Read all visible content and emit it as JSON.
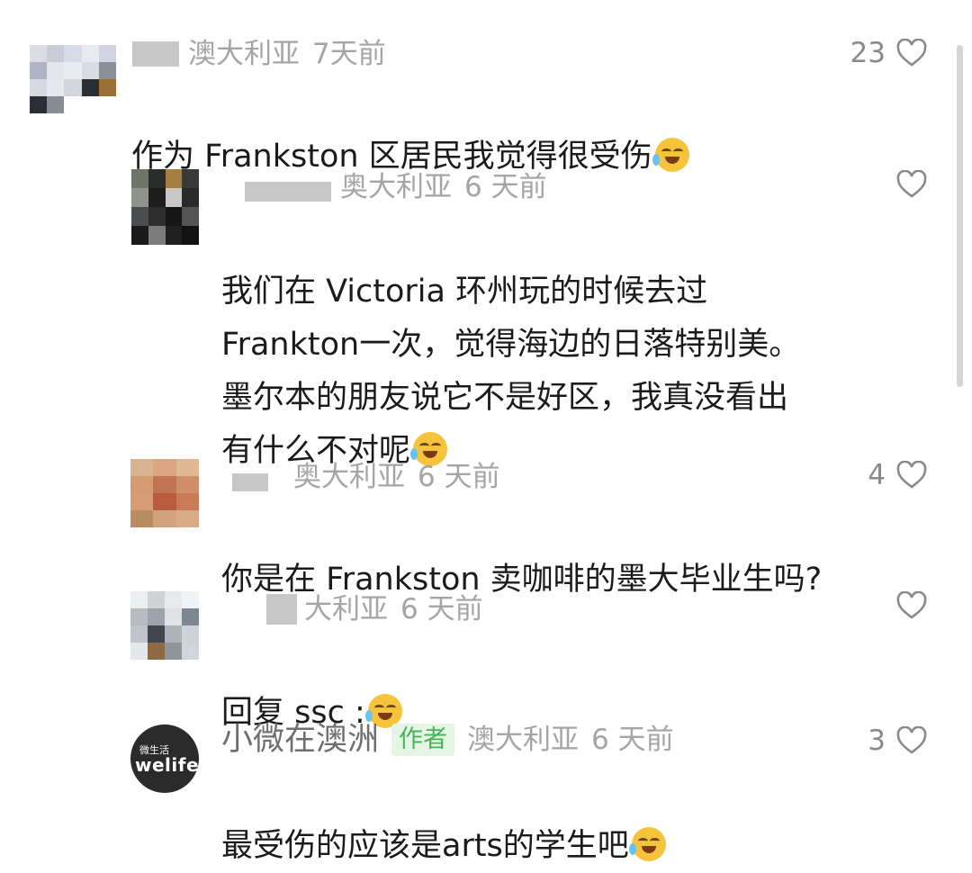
{
  "comments": [
    {
      "location": "澳大利亚",
      "time": "7天前",
      "text": "作为 Frankston 区居民我觉得很受伤",
      "likes": "23",
      "avatar_colors": [
        "#dcdde4",
        "#c9cdd8",
        "#d6dbe8",
        "#e8eaf0",
        "#cfd4e0",
        "#aeb4c4",
        "#e3e6ee",
        "#e9ebf1",
        "#d7dbe3",
        "#8a8f9a",
        "#d5d9e0",
        "#e6e8ed",
        "#d2d5dc",
        "#2a2d34",
        "#9a7236",
        "#2b2e36",
        "#888c96"
      ]
    },
    {
      "location": "奥大利亚",
      "time": "6 天前",
      "text": "我们在 Victoria 环州玩的时候去过\nFrankton一次，觉得海边的日落特别美。\n墨尔本的朋友说它不是好区，我真没看出\n有什么不对呢",
      "likes": "",
      "avatar_colors": [
        "#6f7466",
        "#2a2b2b",
        "#a67e3f",
        "#3a3a3a",
        "#8f9389",
        "#1d1d1d",
        "#c8c9c6",
        "#2a2a2a",
        "#4b4c4d",
        "#2d2d2d",
        "#161616",
        "#545454",
        "#1a1a1a",
        "#7b7b7b",
        "#202020",
        "#121212"
      ]
    },
    {
      "location": "奥大利亚",
      "time": "6 天前",
      "text": "你是在 Frankston 卖咖啡的墨大毕业生吗?",
      "likes": "4",
      "avatar_colors": [
        "#d8b38f",
        "#d9a681",
        "#e0b891",
        "#d39c73",
        "#c07452",
        "#cf8f6a",
        "#d89c78",
        "#b85c3d",
        "#c97b58",
        "#b98b60",
        "#d2a27c",
        "#d8ab86"
      ]
    },
    {
      "location": "大利亚",
      "time": "6 天前",
      "text": "回复 ssc :",
      "likes": "",
      "avatar_colors": [
        "#eceef0",
        "#cfd3d8",
        "#e7e9ec",
        "#f1f2f3",
        "#b7bcc3",
        "#9ea3ab",
        "#dfe2e6",
        "#7e8690",
        "#c0c5cb",
        "#3f4650",
        "#aeb4bb",
        "#cfd3d8",
        "#e5e7ea",
        "#8c6a43",
        "#8f959c",
        "#d1d5da"
      ]
    },
    {
      "name": "小微在澳洲",
      "badge": "作者",
      "location": "澳大利亚",
      "time": "6 天前",
      "text": "最受伤的应该是arts的学生吧",
      "likes": "3",
      "avatar_text_top": "微生活",
      "avatar_text_main": "welife"
    }
  ]
}
